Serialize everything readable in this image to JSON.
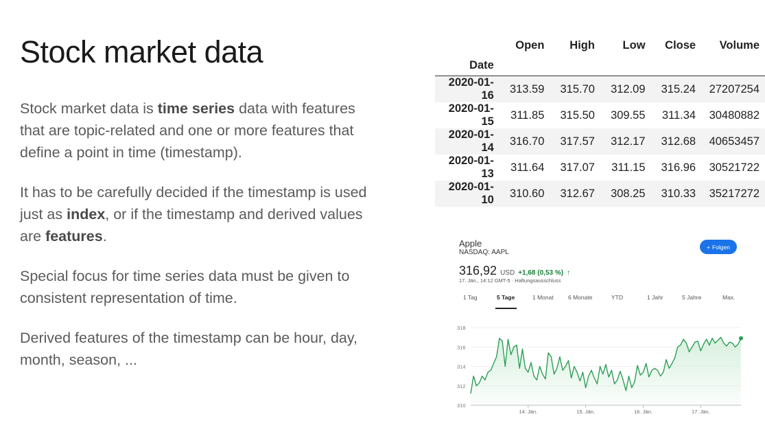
{
  "slide": {
    "title": "Stock market data",
    "para1": {
      "t1": "Stock market data is ",
      "b1": "time series",
      "t2": " data with features that are topic-related and one or more features that define a point in time (timestamp)."
    },
    "para2": {
      "t1": "It has to be carefully decided if the timestamp is used just as ",
      "b1": "index",
      "t2": ", or if the timestamp and derived values are ",
      "b2": "features",
      "t3": "."
    },
    "para3": "Special focus for time series data must be given to consistent representation of time.",
    "para4": "Derived features of the timestamp can be hour, day, month, season, ..."
  },
  "table": {
    "columns": [
      "Open",
      "High",
      "Low",
      "Close",
      "Volume"
    ],
    "index_name": "Date",
    "rows": [
      {
        "date": "2020-01-16",
        "open": "313.59",
        "high": "315.70",
        "low": "312.09",
        "close": "315.24",
        "volume": "27207254"
      },
      {
        "date": "2020-01-15",
        "open": "311.85",
        "high": "315.50",
        "low": "309.55",
        "close": "311.34",
        "volume": "30480882"
      },
      {
        "date": "2020-01-14",
        "open": "316.70",
        "high": "317.57",
        "low": "312.17",
        "close": "312.68",
        "volume": "40653457"
      },
      {
        "date": "2020-01-13",
        "open": "311.64",
        "high": "317.07",
        "low": "311.15",
        "close": "316.96",
        "volume": "30521722"
      },
      {
        "date": "2020-01-10",
        "open": "310.60",
        "high": "312.67",
        "low": "308.25",
        "close": "310.33",
        "volume": "35217272"
      }
    ]
  },
  "stock_card": {
    "company": "Apple",
    "exchange": "NASDAQ: AAPL",
    "follow_label": "Folgen",
    "price": "316,92",
    "currency": "USD",
    "change": "+1,68 (0,53 %)",
    "timestamp": "17. Jän., 14:12 GMT-5 · Haftungsausschluss",
    "tabs": [
      "1 Tag",
      "5 Tage",
      "1 Monat",
      "6 Monate",
      "YTD",
      "1 Jahr",
      "5 Jahre",
      "Max."
    ],
    "active_tab": "5 Tage",
    "colors": {
      "accent": "#1a73e8",
      "positive": "#188038",
      "line": "#2e9e57",
      "fill": "#d6efdd"
    }
  },
  "chart_data": {
    "type": "area",
    "title": "",
    "xlabel": "",
    "ylabel": "",
    "ylim": [
      310,
      318
    ],
    "yticks": [
      "310",
      "312",
      "314",
      "316",
      "318"
    ],
    "xticks": [
      {
        "label": "14. Jän.",
        "x": 1
      },
      {
        "label": "15. Jän.",
        "x": 2
      },
      {
        "label": "16. Jän.",
        "x": 3
      },
      {
        "label": "17. Jän.",
        "x": 4
      }
    ],
    "xlim": [
      0.0,
      4.7
    ],
    "x": [
      0.0,
      0.05,
      0.1,
      0.15,
      0.2,
      0.25,
      0.3,
      0.35,
      0.4,
      0.45,
      0.5,
      0.55,
      0.6,
      0.65,
      0.7,
      0.75,
      0.8,
      0.85,
      0.9,
      0.95,
      1.0,
      1.05,
      1.1,
      1.15,
      1.2,
      1.25,
      1.3,
      1.35,
      1.4,
      1.45,
      1.5,
      1.55,
      1.6,
      1.65,
      1.7,
      1.75,
      1.8,
      1.85,
      1.9,
      1.95,
      2.0,
      2.05,
      2.1,
      2.15,
      2.2,
      2.25,
      2.3,
      2.35,
      2.4,
      2.45,
      2.5,
      2.55,
      2.6,
      2.65,
      2.7,
      2.75,
      2.8,
      2.85,
      2.9,
      2.95,
      3.0,
      3.05,
      3.1,
      3.15,
      3.2,
      3.25,
      3.3,
      3.35,
      3.4,
      3.45,
      3.5,
      3.55,
      3.6,
      3.65,
      3.7,
      3.75,
      3.8,
      3.85,
      3.9,
      3.95,
      4.0,
      4.05,
      4.1,
      4.15,
      4.2,
      4.25,
      4.3,
      4.35,
      4.4,
      4.45,
      4.5,
      4.55,
      4.6,
      4.65,
      4.7
    ],
    "series": [
      {
        "values": [
          311.2,
          313.0,
          312.0,
          312.3,
          313.0,
          312.6,
          313.4,
          313.6,
          314.3,
          315.0,
          316.9,
          316.6,
          314.0,
          316.8,
          315.2,
          316.0,
          316.2,
          313.8,
          315.8,
          313.8,
          313.4,
          314.4,
          313.0,
          312.6,
          314.0,
          313.2,
          312.7,
          315.4,
          315.0,
          313.2,
          313.8,
          315.0,
          313.6,
          314.0,
          314.6,
          312.8,
          314.0,
          313.4,
          312.5,
          313.4,
          311.8,
          313.0,
          313.6,
          312.8,
          312.2,
          314.0,
          313.2,
          314.2,
          312.9,
          313.6,
          312.2,
          312.6,
          313.5,
          312.6,
          311.5,
          313.0,
          311.8,
          312.4,
          314.1,
          313.1,
          313.4,
          314.3,
          312.9,
          313.6,
          313.8,
          313.6,
          313.0,
          313.4,
          314.7,
          313.8,
          314.3,
          314.9,
          316.0,
          316.2,
          316.8,
          316.4,
          315.5,
          316.0,
          316.5,
          316.6,
          315.6,
          316.3,
          316.8,
          316.2,
          316.9,
          316.4,
          316.7,
          317.0,
          316.4,
          316.1,
          316.5,
          316.4,
          316.0,
          316.3,
          316.9
        ]
      }
    ]
  }
}
